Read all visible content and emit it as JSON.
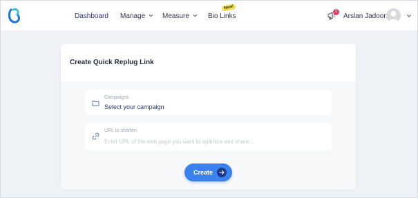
{
  "header": {
    "nav": {
      "dashboard": "Dashboard",
      "manage": "Manage",
      "measure": "Measure",
      "bio_links": "Bio Links",
      "new_badge": "New!"
    },
    "notifications": {
      "count": "1",
      "icon": "megaphone-icon"
    },
    "user": {
      "name": "Arslan Jadoon",
      "avatar": "avatar"
    }
  },
  "card": {
    "title": "Create Quick Replug Link",
    "campaign": {
      "label": "Campaigns",
      "value": "Select your campaign",
      "icon": "folder-icon"
    },
    "url": {
      "label": "URL to shorten",
      "placeholder": "Enter URL of the web page you want to optimize and share...",
      "icon": "link-icon"
    },
    "create_button": "Create"
  },
  "colors": {
    "accent": "#3b82f0",
    "nav_active": "#2a3580",
    "badge": "#f7e14a",
    "notification": "#e53e6a"
  }
}
